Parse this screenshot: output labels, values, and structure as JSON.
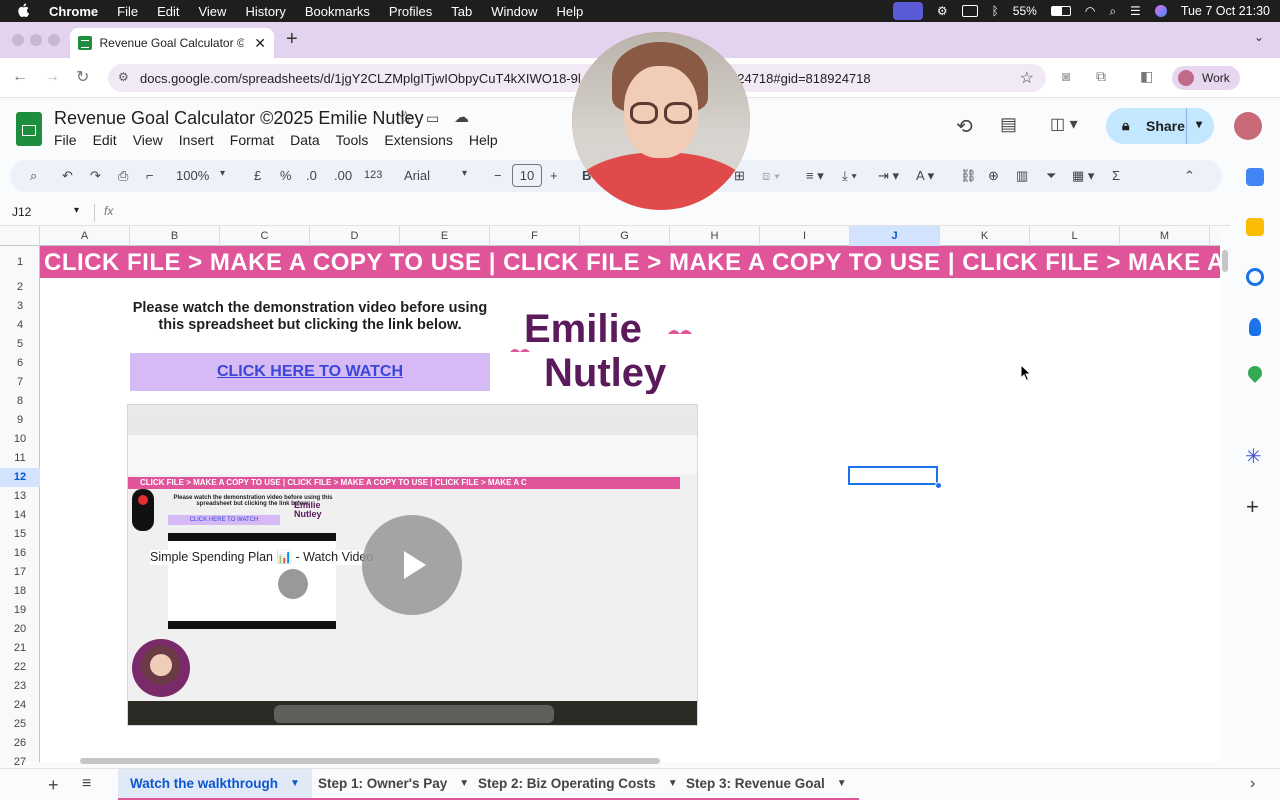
{
  "mac_menu": {
    "apple": "",
    "app": "Chrome",
    "items": [
      "File",
      "Edit",
      "View",
      "History",
      "Bookmarks",
      "Profiles",
      "Tab",
      "Window",
      "Help"
    ],
    "battery": "55%",
    "datetime": "Tue 7 Oct  21:30"
  },
  "browser": {
    "tab_title": "Revenue Goal Calculator ©20",
    "url": "docs.google.com/spreadsheets/d/1jgY2CLZMplgITjwIObpyCuT4kXIWO18-9l",
    "url_tail": "924718#gid=818924718",
    "profile": "Work"
  },
  "doc": {
    "title": "Revenue Goal Calculator ©2025 Emilie Nutley",
    "menus": [
      "File",
      "Edit",
      "View",
      "Insert",
      "Format",
      "Data",
      "Tools",
      "Extensions",
      "Help"
    ],
    "share_label": "Share"
  },
  "toolbar": {
    "zoom": "100%",
    "currency": "£",
    "percent": "%",
    "dec_decrease": ".0",
    "dec_increase": ".00",
    "format_num": "123",
    "font": "Arial",
    "font_size": "10",
    "minus": "−",
    "plus": "+",
    "bold": "B"
  },
  "formula_bar": {
    "cell_ref": "J12",
    "fx": "fx",
    "value": ""
  },
  "grid": {
    "columns": [
      "A",
      "B",
      "C",
      "D",
      "E",
      "F",
      "G",
      "H",
      "I",
      "J",
      "K",
      "L",
      "M"
    ],
    "rows": [
      "1",
      "2",
      "3",
      "4",
      "5",
      "6",
      "7",
      "8",
      "9",
      "10",
      "11",
      "12",
      "13",
      "14",
      "15",
      "16",
      "17",
      "18",
      "19",
      "20",
      "21",
      "22",
      "23",
      "24",
      "25",
      "26",
      "27"
    ],
    "selected_col": "J",
    "selected_row": "12"
  },
  "content": {
    "banner": "CLICK FILE > MAKE A COPY TO USE  |  CLICK FILE > MAKE A COPY TO USE  |  CLICK FILE > MAKE A C",
    "instruction": "Please watch the demonstration video before using this spreadsheet but clicking the link below.",
    "watch_link": "CLICK HERE TO WATCH",
    "logo_line1": "Emilie",
    "logo_line2": "Nutley",
    "video_title": "Simple Spending Plan 📊 - Watch Video"
  },
  "sheet_tabs": [
    {
      "label": "Watch the walkthrough",
      "active": true
    },
    {
      "label": "Step 1: Owner's Pay",
      "active": false
    },
    {
      "label": "Step 2: Biz Operating Costs",
      "active": false
    },
    {
      "label": "Step 3: Revenue Goal",
      "active": false
    }
  ],
  "colors": {
    "banner_pink": "#e05599",
    "logo_purple": "#5a1a5c",
    "link_blue": "#3b47d8",
    "link_bg": "#d5baf6",
    "share_bg": "#c2e7ff",
    "active_tab": "#1a73e8"
  }
}
